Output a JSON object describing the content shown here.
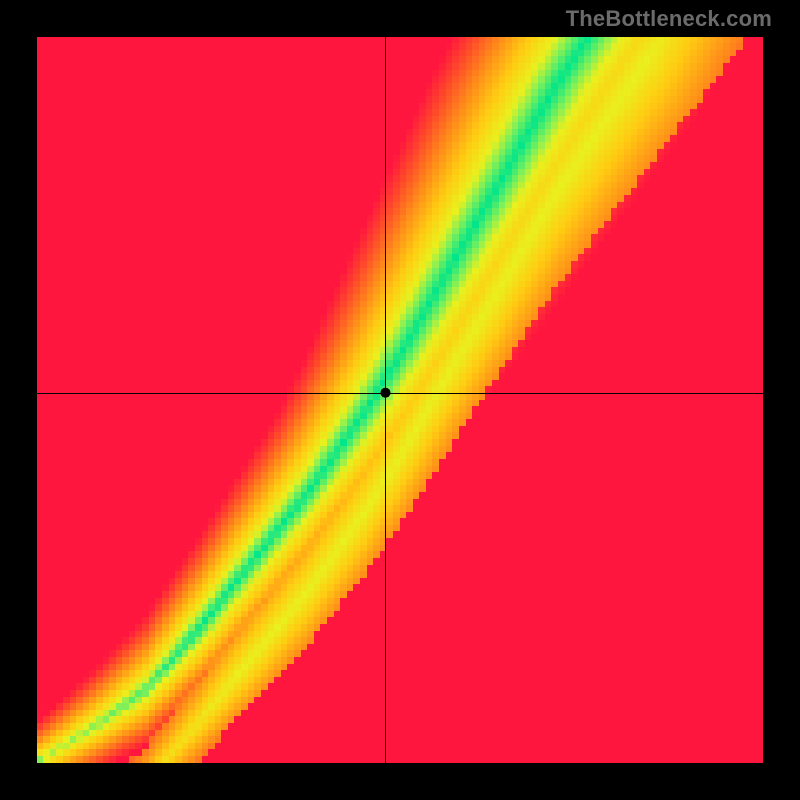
{
  "watermark": "TheBottleneck.com",
  "chart_data": {
    "type": "heatmap",
    "title": "",
    "xlabel": "",
    "ylabel": "",
    "xlim": [
      0,
      100
    ],
    "ylim": [
      0,
      100
    ],
    "marker": {
      "x": 48,
      "y": 51
    },
    "crosshair": {
      "x": 48,
      "y": 51
    },
    "ridge_curve_description": "Green optimal band follows a roughly linear-then-superlinear path from bottom-left to top-right; color = distance from ridge (green→yellow→orange→red).",
    "ridge_samples": [
      {
        "x": 0,
        "y": 0
      },
      {
        "x": 8,
        "y": 5
      },
      {
        "x": 15,
        "y": 10
      },
      {
        "x": 22,
        "y": 18
      },
      {
        "x": 30,
        "y": 28
      },
      {
        "x": 38,
        "y": 38
      },
      {
        "x": 45,
        "y": 48
      },
      {
        "x": 50,
        "y": 56
      },
      {
        "x": 58,
        "y": 70
      },
      {
        "x": 65,
        "y": 82
      },
      {
        "x": 72,
        "y": 94
      },
      {
        "x": 76,
        "y": 100
      }
    ],
    "colorscale": [
      {
        "t": 0.0,
        "hex": "#00e58b"
      },
      {
        "t": 0.12,
        "hex": "#7ef05a"
      },
      {
        "t": 0.22,
        "hex": "#e9f01e"
      },
      {
        "t": 0.4,
        "hex": "#ffcb12"
      },
      {
        "t": 0.62,
        "hex": "#ff8a1a"
      },
      {
        "t": 0.82,
        "hex": "#ff4a2a"
      },
      {
        "t": 1.0,
        "hex": "#ff163e"
      }
    ]
  }
}
